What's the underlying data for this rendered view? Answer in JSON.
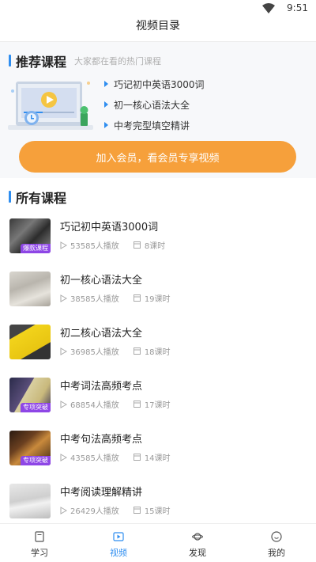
{
  "status_bar": {
    "time": "9:51"
  },
  "navbar": {
    "title": "视频目录"
  },
  "recommended": {
    "title": "推荐课程",
    "subtitle": "大家都在看的热门课程",
    "items": [
      {
        "label": "巧记初中英语3000词"
      },
      {
        "label": "初一核心语法大全"
      },
      {
        "label": "中考完型填空精讲"
      }
    ],
    "join_button": "加入会员，看会员专享视频"
  },
  "all_courses": {
    "title": "所有课程",
    "courses": [
      {
        "title": "巧记初中英语3000词",
        "plays": "53585人播放",
        "lessons": "8课时",
        "tag": "爆款课程"
      },
      {
        "title": "初一核心语法大全",
        "plays": "38585人播放",
        "lessons": "19课时",
        "tag": ""
      },
      {
        "title": "初二核心语法大全",
        "plays": "36985人播放",
        "lessons": "18课时",
        "tag": ""
      },
      {
        "title": "中考词法高频考点",
        "plays": "68854人播放",
        "lessons": "17课时",
        "tag": "专项突破"
      },
      {
        "title": "中考句法高频考点",
        "plays": "43585人播放",
        "lessons": "14课时",
        "tag": "专项突破"
      },
      {
        "title": "中考阅读理解精讲",
        "plays": "26429人播放",
        "lessons": "15课时",
        "tag": ""
      }
    ]
  },
  "tabbar": {
    "tabs": [
      {
        "label": "学习"
      },
      {
        "label": "视频"
      },
      {
        "label": "发现"
      },
      {
        "label": "我的"
      }
    ],
    "active": "视频"
  },
  "colors": {
    "accent": "#2f8ef0",
    "orange": "#f6a03b",
    "tag_purple": "#8e46e6"
  }
}
